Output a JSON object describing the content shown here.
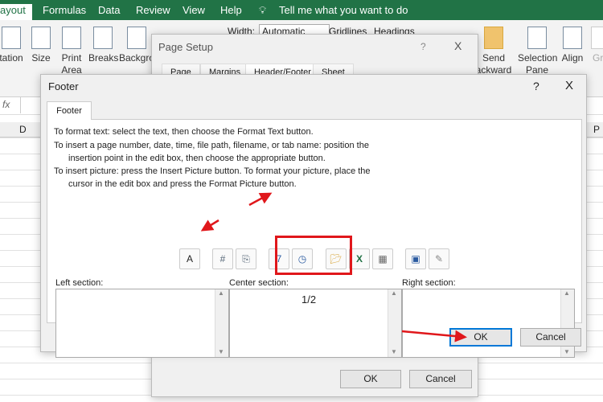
{
  "ribbon_tabs": [
    "ayout",
    "Formulas",
    "Data",
    "Review",
    "View",
    "Help"
  ],
  "tell_me": "Tell me what you want to do",
  "ribbon_buttons": [
    "tation",
    "Size",
    "Print\nArea",
    "Breaks",
    "Backgro",
    "Send\nackward",
    "Selection\nPane",
    "Align",
    "Gro"
  ],
  "width_label": "Width:",
  "width_value": "Automatic",
  "gridlines": "Gridlines",
  "headings": "Headings",
  "formula_fx": "fx",
  "columns": [
    "D",
    "P"
  ],
  "page_setup": {
    "title": "Page Setup",
    "help": "?",
    "close": "X",
    "tabs": [
      "Page",
      "Margins",
      "Header/Footer",
      "Sheet"
    ],
    "ok": "OK",
    "cancel": "Cancel"
  },
  "footer": {
    "title": "Footer",
    "help": "?",
    "close": "X",
    "tab": "Footer",
    "instructions": [
      "To format text:  select the text, then choose the Format Text button.",
      "To insert a page number, date, time, file path, filename, or tab name:  position the",
      "insertion point in the edit box, then choose the appropriate button.",
      "To insert picture: press the Insert Picture button.  To format your picture, place the",
      "cursor in the edit box and press the Format Picture button."
    ],
    "format_text_btn": "A",
    "left_label": "Left section:",
    "center_label": "Center section:",
    "right_label": "Right section:",
    "center_value": "1/2",
    "left_value": "",
    "right_value": "",
    "ok": "OK",
    "cancel": "Cancel"
  },
  "colors": {
    "excel_green": "#217346",
    "annotation_red": "#e0171b"
  }
}
